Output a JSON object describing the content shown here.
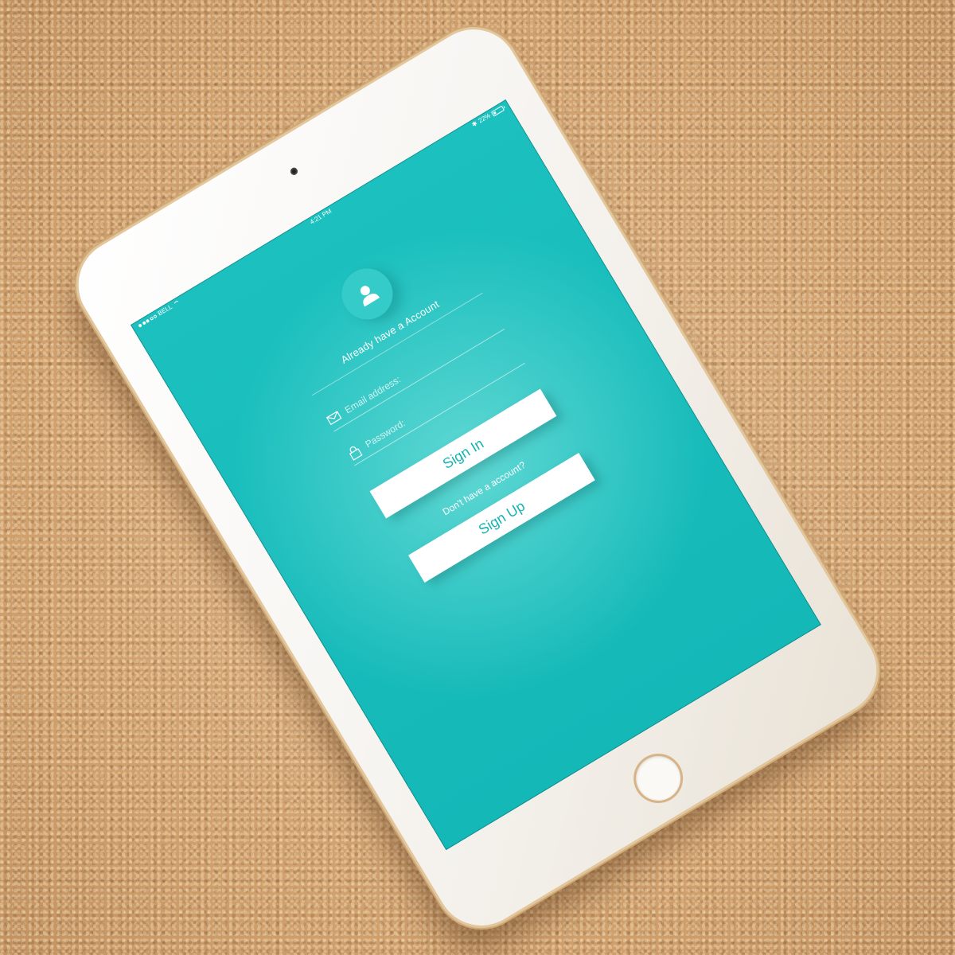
{
  "status_bar": {
    "carrier": "BELL",
    "time": "4:21 PM",
    "battery": "22%"
  },
  "login": {
    "heading": "Already have a Account",
    "email_placeholder": "Email address:",
    "password_placeholder": "Password:",
    "signin_label": "Sign In",
    "signup_prompt": "Don't have a account?",
    "signup_label": "Sign Up"
  },
  "icons": {
    "avatar": "user-icon",
    "email": "envelope-icon",
    "password": "lock-icon",
    "bluetooth": "bluetooth-icon",
    "battery": "battery-icon",
    "wifi": "wifi-icon"
  },
  "colors": {
    "screen_teal": "#17bcbb",
    "button_text": "#14b3b2",
    "avatar_circle": "#34cbc8",
    "device_frame": "#ffffff",
    "device_rim_gold": "#cfa978",
    "carpet": "#d4a877"
  }
}
